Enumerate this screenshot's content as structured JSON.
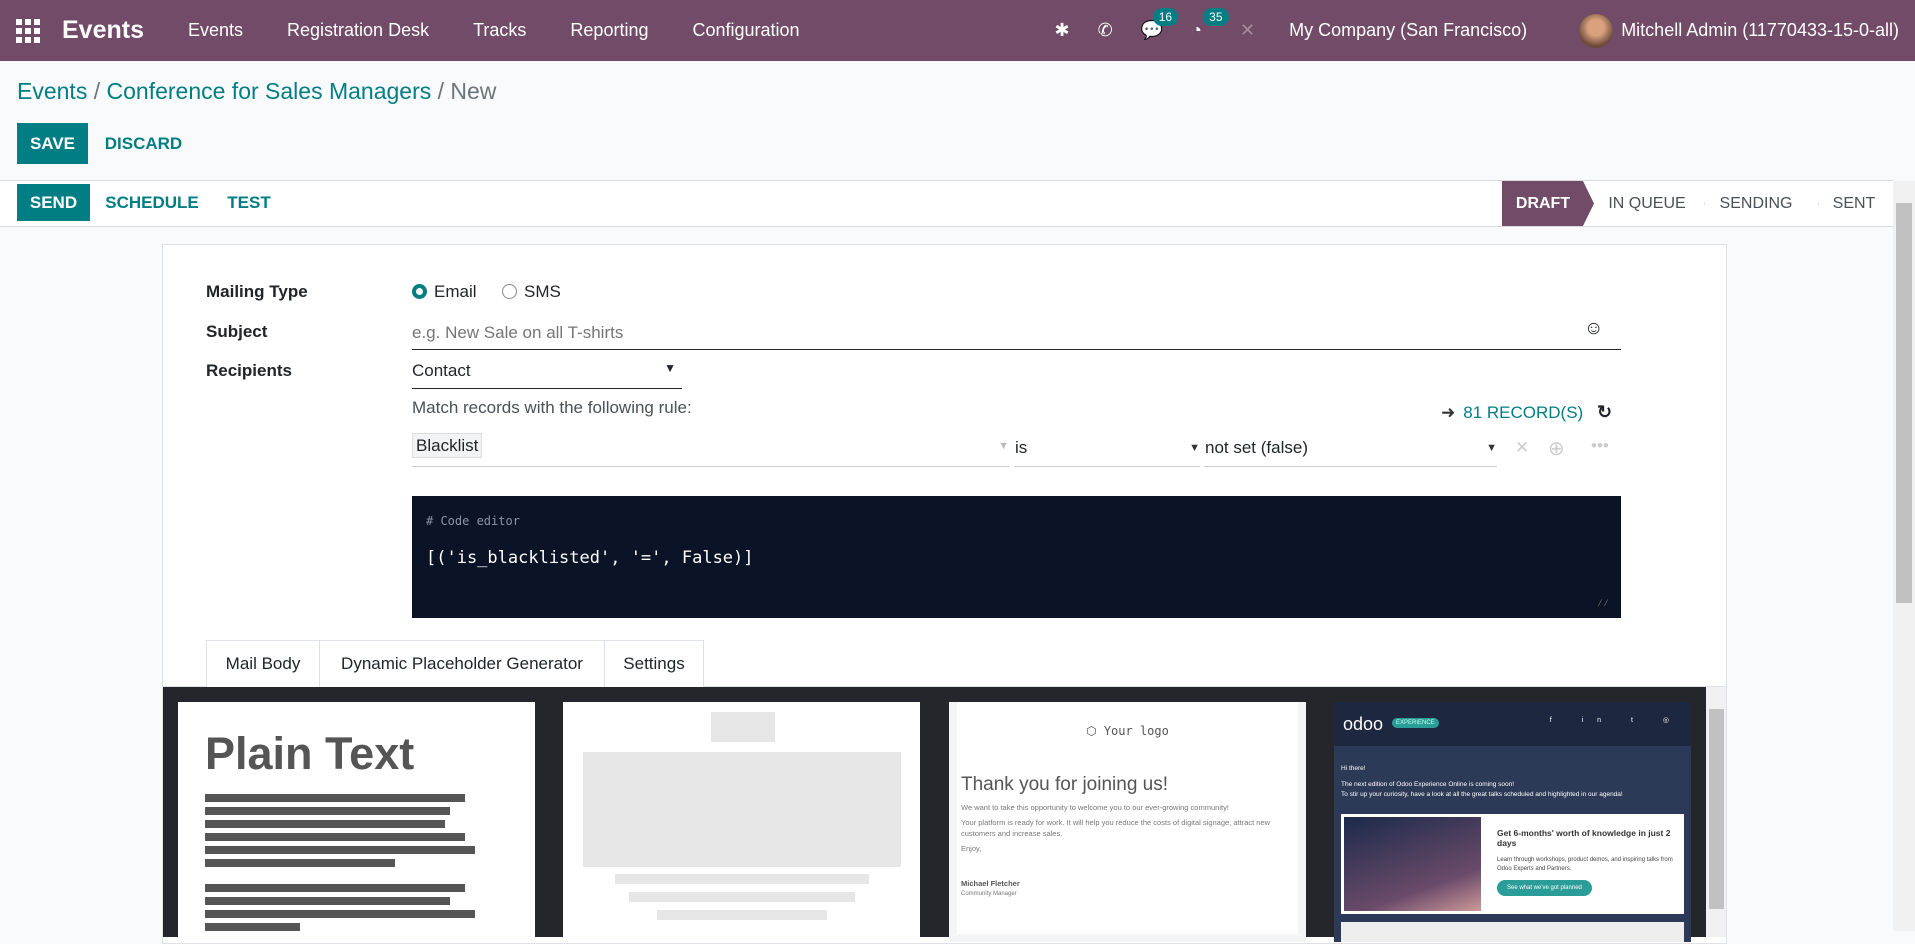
{
  "navbar": {
    "app_name": "Events",
    "menus": [
      "Events",
      "Registration Desk",
      "Tracks",
      "Reporting",
      "Configuration"
    ],
    "messages_count": "16",
    "activities_count": "35",
    "company": "My Company (San Francisco)",
    "user": "Mitchell Admin (11770433-15-0-all)",
    "color": "#714B67"
  },
  "breadcrumb": {
    "items": [
      "Events",
      "Conference for Sales Managers"
    ],
    "current": "New",
    "sep": " / "
  },
  "actions": {
    "save": "SAVE",
    "discard": "DISCARD",
    "send": "SEND",
    "schedule": "SCHEDULE",
    "test": "TEST"
  },
  "statusbar": {
    "stages": [
      "DRAFT",
      "IN QUEUE",
      "SENDING",
      "SENT"
    ],
    "active": "DRAFT"
  },
  "form": {
    "mailing_type_label": "Mailing Type",
    "mailing_type_options": [
      "Email",
      "SMS"
    ],
    "mailing_type_value": "Email",
    "subject_label": "Subject",
    "subject_placeholder": "e.g. New Sale on all T-shirts",
    "recipients_label": "Recipients",
    "recipients_value": "Contact",
    "rule_text": "Match records with the following rule:",
    "records_count": "81 RECORD(S)",
    "rule": {
      "field": "Blacklist",
      "operator": "is",
      "value": "not set (false)"
    },
    "code_comment": "# Code editor",
    "code": "[('is_blacklisted', '=', False)]"
  },
  "tabs": [
    "Mail Body",
    "Dynamic Placeholder Generator",
    "Settings"
  ],
  "templates": {
    "plain_text": "Plain Text",
    "welcome": {
      "logo": "Your logo",
      "title": "Thank you for joining us!",
      "line1": "We want to take this opportunity to welcome you to our ever-growing community!",
      "line2": "Your platform is ready for work. It will help you reduce the costs of digital signage, attract new customers and increase sales.",
      "enjoy": "Enjoy,",
      "name": "Michael Fletcher",
      "role": "Community Manager"
    },
    "event": {
      "logo": "odoo",
      "tag": "EXPERIENCE",
      "hi": "Hi there!",
      "line1": "The next edition of Odoo Experience Online is coming soon!",
      "line2": "To stir up your curiosity, have a look at all the great talks scheduled and highlighted in our agenda!",
      "headline": "Get 6-months' worth of knowledge in just 2 days",
      "body": "Learn through workshops, product demos, and inspiring talks from Odoo Experts and Partners.",
      "cta": "See what we've got planned"
    }
  }
}
